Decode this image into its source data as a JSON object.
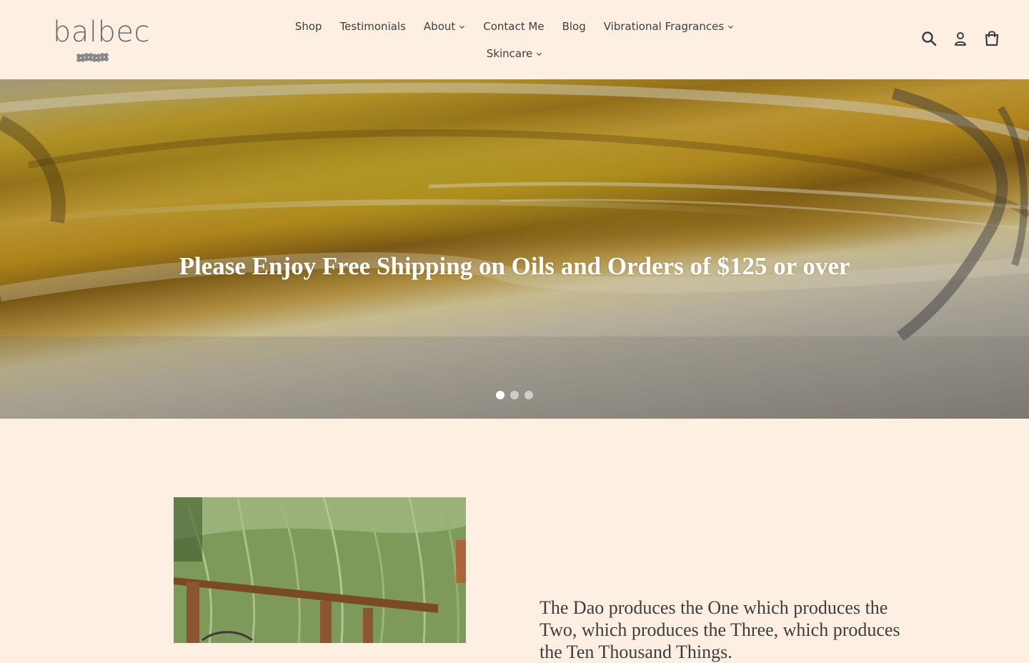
{
  "logo": {
    "text": "balbec",
    "flowers_icon": "flower-cluster-icon"
  },
  "nav": {
    "items": [
      {
        "label": "Shop",
        "dropdown": false
      },
      {
        "label": "Testimonials",
        "dropdown": false
      },
      {
        "label": "About",
        "dropdown": true
      },
      {
        "label": "Contact Me",
        "dropdown": false
      },
      {
        "label": "Blog",
        "dropdown": false
      },
      {
        "label": "Vibrational Fragrances",
        "dropdown": true
      },
      {
        "label": "Skincare",
        "dropdown": true
      }
    ]
  },
  "header_icons": {
    "search": "search-icon",
    "account": "account-icon",
    "cart": "cart-icon"
  },
  "hero": {
    "title": "Please Enjoy Free Shipping on Oils and Orders of $125 or over",
    "slide_count": 3,
    "active_slide": 1
  },
  "feature": {
    "text": "The Dao produces the One which produces the Two, which produces the Three, which produces the Ten Thousand Things."
  },
  "colors": {
    "background": "#fdf0e2",
    "text": "#3d3d3d",
    "hero_text": "#ffffff"
  }
}
